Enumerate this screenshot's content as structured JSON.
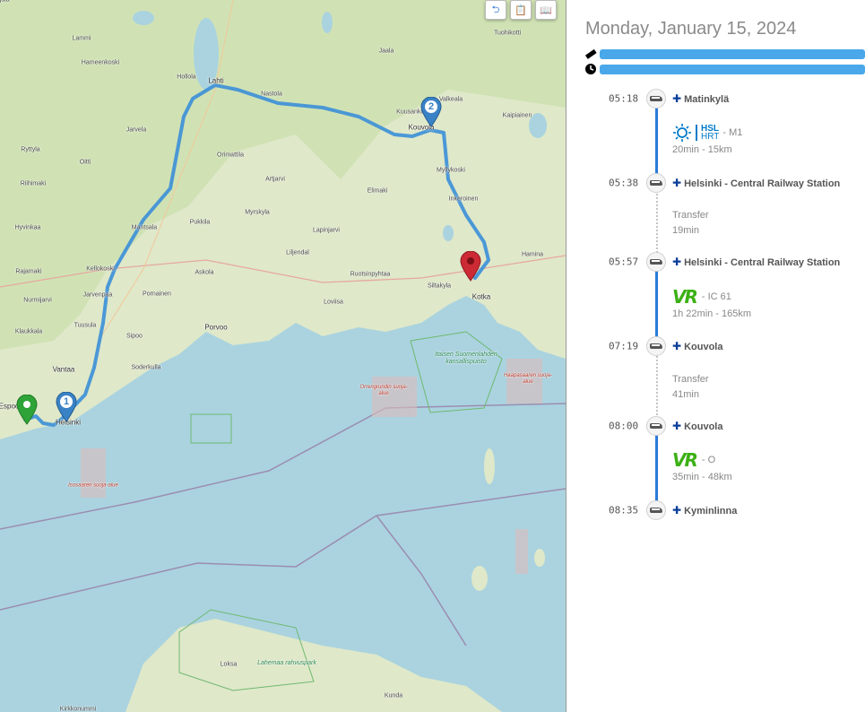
{
  "map": {
    "controls": [
      {
        "name": "route-icon",
        "glyph": "⮌"
      },
      {
        "name": "clipboard-icon",
        "glyph": "📋"
      },
      {
        "name": "book-icon",
        "glyph": "📖"
      }
    ],
    "places": [
      {
        "name": "Tuohikotti"
      },
      {
        "name": "Jaala"
      },
      {
        "name": "Lammi"
      },
      {
        "name": "Hameenkoski"
      },
      {
        "name": "Hollola"
      },
      {
        "name": "Lahti"
      },
      {
        "name": "Nastola"
      },
      {
        "name": "Kuusankoski"
      },
      {
        "name": "Valkeala"
      },
      {
        "name": "Kaipiainen"
      },
      {
        "name": "Kouvola"
      },
      {
        "name": "Jarvela"
      },
      {
        "name": "Orimattila"
      },
      {
        "name": "Myllykoski"
      },
      {
        "name": "Inkeroinen"
      },
      {
        "name": "Artjarvi"
      },
      {
        "name": "Elimaki"
      },
      {
        "name": "Pukkila"
      },
      {
        "name": "Myrskyla"
      },
      {
        "name": "Lapinjarvi"
      },
      {
        "name": "Mantsala"
      },
      {
        "name": "Hamina"
      },
      {
        "name": "Liljendal"
      },
      {
        "name": "Askola"
      },
      {
        "name": "Ruotsinpyhtaa"
      },
      {
        "name": "Kellokoski"
      },
      {
        "name": "Pornainen"
      },
      {
        "name": "Jarvenpaa"
      },
      {
        "name": "Loviisa"
      },
      {
        "name": "Siltakyla"
      },
      {
        "name": "Kotka"
      },
      {
        "name": "Tuusula"
      },
      {
        "name": "Sipoo"
      },
      {
        "name": "Porvoo"
      },
      {
        "name": "Soderkulla"
      },
      {
        "name": "Vantaa"
      },
      {
        "name": "Espoo"
      },
      {
        "name": "Helsinki"
      },
      {
        "name": "Kirkkonummi"
      },
      {
        "name": "Klaukkala"
      },
      {
        "name": "Nurmijarvi"
      },
      {
        "name": "Rajamaki"
      },
      {
        "name": "Hyvinkaa"
      },
      {
        "name": "Riihimaki"
      },
      {
        "name": "Ryttyla"
      },
      {
        "name": "Oitti"
      },
      {
        "name": "Loksa"
      },
      {
        "name": "Kunda"
      },
      {
        "name": "Haljala"
      }
    ],
    "parks": [
      {
        "name": "Itaisen Suomenlahden kansallispuisto"
      },
      {
        "name": "Lahemaa rahvuspark"
      }
    ],
    "reserves": [
      {
        "name": "Orrengrundin suoja-alue"
      },
      {
        "name": "Haapasaaren suoja-alue"
      },
      {
        "name": "Isosaaren suoja-alue"
      }
    ],
    "markers": [
      {
        "name": "start-marker",
        "label": "",
        "color": "#2ea337"
      },
      {
        "name": "waypoint-1-marker",
        "label": "1",
        "color": "#3a82c6"
      },
      {
        "name": "waypoint-2-marker",
        "label": "2",
        "color": "#3a82c6"
      },
      {
        "name": "destination-marker",
        "label": "",
        "color": "#cc2a34"
      }
    ],
    "route_color": "#3b8fd8"
  },
  "panel": {
    "date": "Monday, January 15, 2024",
    "distance_icon": "ruler-icon",
    "duration_icon": "clock-icon",
    "distance_bar_fraction": 1.0,
    "duration_bar_fraction": 1.0,
    "stops": [
      {
        "time": "05:18",
        "name": "Matinkylä"
      },
      {
        "time": "05:38",
        "name": "Helsinki - Central Railway Station"
      },
      {
        "time": "05:57",
        "name": "Helsinki - Central Railway Station"
      },
      {
        "time": "07:19",
        "name": "Kouvola"
      },
      {
        "time": "08:00",
        "name": "Kouvola"
      },
      {
        "time": "08:35",
        "name": "Kyminlinna"
      }
    ],
    "legs": [
      {
        "operator_line1": "HSL",
        "operator_line2": "HRT",
        "route": "- M1",
        "stats": "20min - 15km"
      },
      {
        "operator_line1": "VR",
        "route": "- IC 61",
        "stats": "1h 22min - 165km"
      },
      {
        "operator_line1": "VR",
        "route": "- O",
        "stats": "35min - 48km"
      }
    ],
    "transfers": [
      {
        "label": "Transfer",
        "duration": "19min"
      },
      {
        "label": "Transfer",
        "duration": "41min"
      }
    ],
    "flag_glyph": "✚",
    "accent": "#2a7bd8",
    "bar_color": "#4aa8ea"
  }
}
